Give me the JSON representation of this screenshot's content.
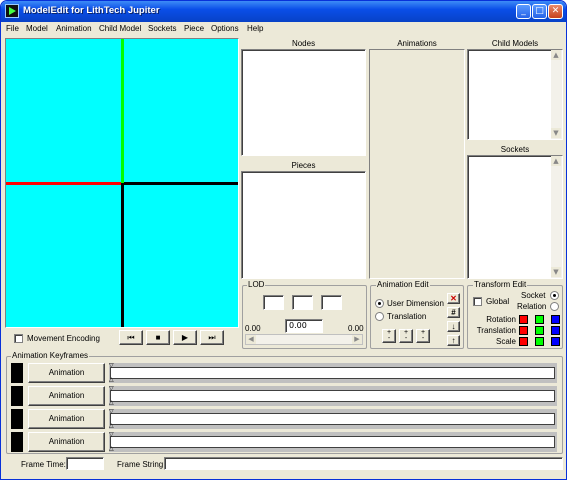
{
  "window": {
    "title": "ModelEdit for LithTech Jupiter"
  },
  "menu": [
    "File",
    "Model",
    "Animation",
    "Child Model",
    "Sockets",
    "Piece",
    "Options",
    "Help"
  ],
  "viewport": {
    "background": "#00ffff",
    "movement_encoding_label": "Movement Encoding",
    "playback": {
      "rewind": "⏮",
      "stop": "■",
      "play": "▶",
      "end": "⏭"
    }
  },
  "panels": {
    "nodes_label": "Nodes",
    "pieces_label": "Pieces",
    "animations_label": "Animations",
    "child_models_label": "Child Models",
    "sockets_label": "Sockets"
  },
  "lod": {
    "label": "LOD",
    "min_value": "0.00",
    "current_value": "0.00",
    "max_value": "0.00"
  },
  "animation_edit": {
    "label": "Animation Edit",
    "user_dimension": "User Dimension",
    "translation": "Translation",
    "selected": "user_dimension"
  },
  "transform_edit": {
    "label": "Transform Edit",
    "global": "Global",
    "socket": "Socket",
    "relation": "Relation",
    "rotation": "Rotation",
    "translation": "Translation",
    "scale": "Scale",
    "colors": {
      "x": "#ff0000",
      "y": "#00ff00",
      "z": "#0000ff"
    }
  },
  "keyframes": {
    "label": "Animation Keyframes",
    "rows": [
      {
        "button": "Animation"
      },
      {
        "button": "Animation"
      },
      {
        "button": "Animation"
      },
      {
        "button": "Animation"
      }
    ],
    "frame_time_label": "Frame Time:",
    "frame_string_label": "Frame String:"
  }
}
